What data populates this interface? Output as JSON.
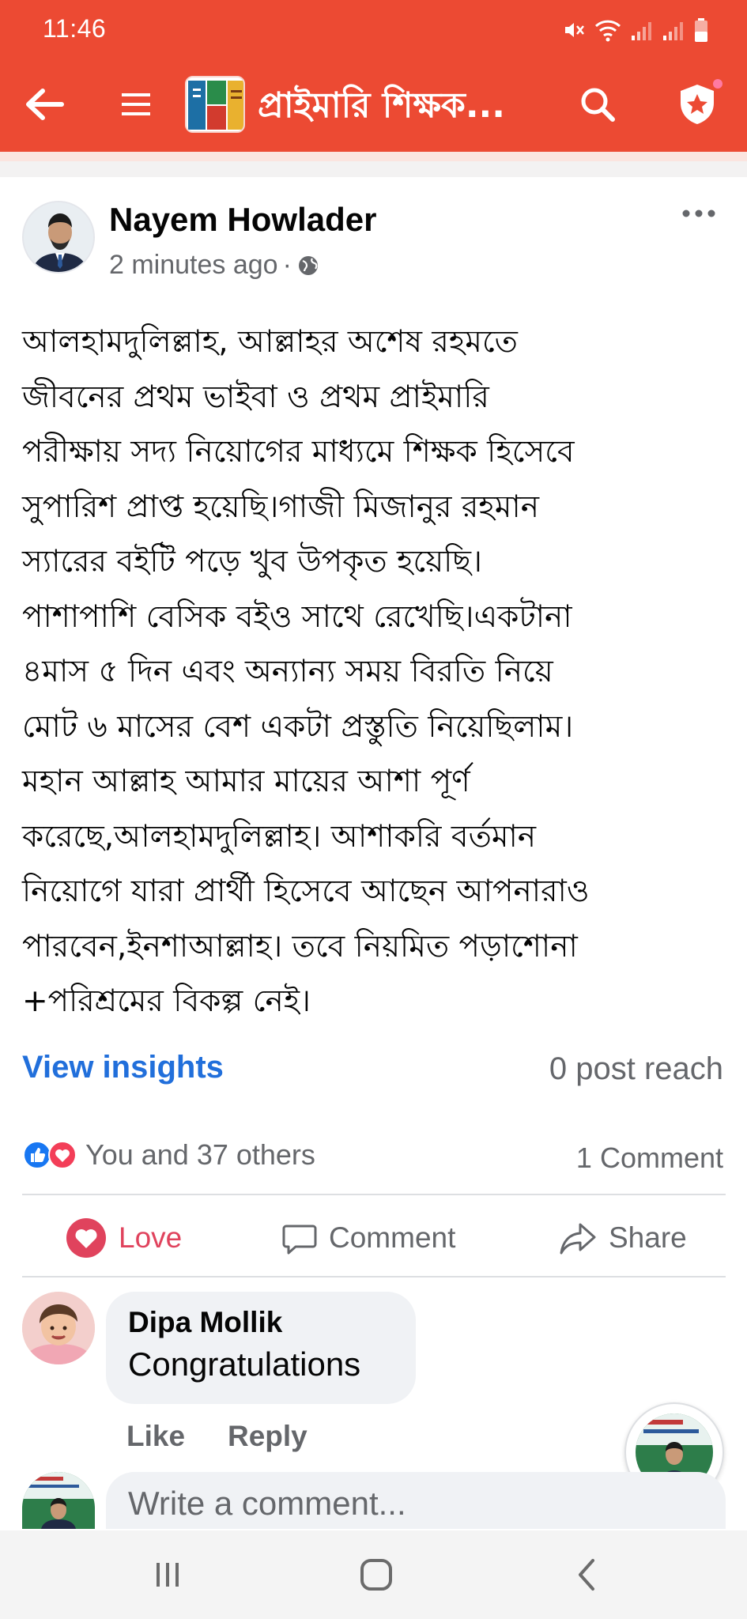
{
  "status_bar": {
    "time": "11:46"
  },
  "app_bar": {
    "group_title": "প্রাইমারি শিক্ষক..."
  },
  "post": {
    "author": "Nayem Howlader",
    "time_ago": "2 minutes ago",
    "meta_separator": "·",
    "body_lines": [
      "আলহামদুলিল্লাহ, আল্লাহর অশেষ রহমতে",
      "জীবনের প্রথম ভাইবা ও প্রথম প্রাইমারি",
      "পরীক্ষায় সদ্য নিয়োগের মাধ্যমে শিক্ষক হিসেবে",
      "সুপারিশ প্রাপ্ত হয়েছি।গাজী মিজানুর রহমান",
      "স্যারের বইটি পড়ে খুব উপকৃত হয়েছি।",
      "পাশাপাশি বেসিক বইও সাথে রেখেছি।একটানা",
      "৪মাস ৫ দিন এবং অন্যান্য সময় বিরতি নিয়ে",
      "মোট ৬ মাসের বেশ একটা প্রস্তুতি নিয়েছিলাম।",
      "মহান আল্লাহ আমার মায়ের আশা পূর্ণ",
      "করেছে,আলহামদুলিল্লাহ। আশাকরি বর্তমান",
      "নিয়োগে যারা প্রার্থী হিসেবে আছেন আপনারাও",
      "পারবেন,ইনশাআল্লাহ। তবে নিয়মিত পড়াশোনা",
      "+পরিশ্রমের বিকল্প নেই।"
    ],
    "view_insights": "View insights",
    "post_reach": "0 post reach",
    "reactions_text": "You and 37 others",
    "comment_count": "1 Comment",
    "actions": {
      "love": "Love",
      "comment": "Comment",
      "share": "Share"
    }
  },
  "comment": {
    "author": "Dipa Mollik",
    "text": "Congratulations",
    "like": "Like",
    "reply": "Reply"
  },
  "composer": {
    "placeholder": "Write a comment..."
  },
  "colors": {
    "brand": "#ec4a33",
    "link": "#216fdb",
    "love": "#e0435d",
    "muted": "#65676b"
  },
  "icons": [
    "back-arrow-icon",
    "menu-icon",
    "search-icon",
    "shield-star-icon",
    "more-icon",
    "globe-icon",
    "like-reaction-icon",
    "love-reaction-icon",
    "heart-icon",
    "comment-icon",
    "share-icon",
    "recent-apps-icon",
    "home-icon",
    "nav-back-icon"
  ]
}
